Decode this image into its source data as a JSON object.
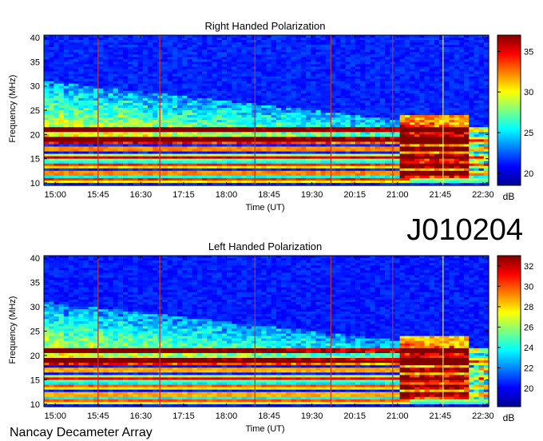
{
  "figure": {
    "station": "Nancay Decameter Array",
    "date_code": "J010204"
  },
  "chart_data": [
    {
      "type": "heatmap",
      "title": "Right Handed Polarization",
      "xlabel": "Time (UT)",
      "ylabel": "Frequency (MHz)",
      "x_ticks": [
        "15:00",
        "15:45",
        "16:30",
        "17:15",
        "18:00",
        "18:45",
        "19:30",
        "20:15",
        "21:00",
        "21:45",
        "22:30"
      ],
      "x_range": [
        "14:48",
        "22:36"
      ],
      "y_ticks": [
        10,
        15,
        20,
        25,
        30,
        35,
        40
      ],
      "ylim": [
        9.5,
        40.5
      ],
      "colorbar": {
        "label": "dB",
        "ticks": [
          20,
          25,
          30,
          35
        ],
        "range": [
          18.5,
          37
        ]
      },
      "colormap": "jet",
      "vertical_markers": [
        {
          "time": "15:45",
          "color": "#c03030"
        },
        {
          "time": "16:50",
          "color": "#c03030"
        },
        {
          "time": "18:30",
          "color": "#c03030"
        },
        {
          "time": "19:50",
          "color": "#c03030"
        },
        {
          "time": "20:55",
          "color": "#c03030"
        },
        {
          "time": "21:48",
          "color": "#e8e060"
        }
      ]
    },
    {
      "type": "heatmap",
      "title": "Left Handed Polarization",
      "xlabel": "Time (UT)",
      "ylabel": "Frequency (MHz)",
      "x_ticks": [
        "15:00",
        "15:45",
        "16:30",
        "17:15",
        "18:00",
        "18:45",
        "19:30",
        "20:15",
        "21:00",
        "21:45",
        "22:30"
      ],
      "x_range": [
        "14:48",
        "22:36"
      ],
      "y_ticks": [
        10,
        15,
        20,
        25,
        30,
        35,
        40
      ],
      "ylim": [
        9.5,
        40.5
      ],
      "colorbar": {
        "label": "dB",
        "ticks": [
          20,
          22,
          24,
          26,
          28,
          30,
          32
        ],
        "range": [
          18.2,
          33
        ]
      },
      "colormap": "jet",
      "vertical_markers": [
        {
          "time": "15:45",
          "color": "#c03030"
        },
        {
          "time": "16:50",
          "color": "#c03030"
        },
        {
          "time": "18:30",
          "color": "#c03030"
        },
        {
          "time": "19:50",
          "color": "#c03030"
        },
        {
          "time": "20:55",
          "color": "#c03030"
        },
        {
          "time": "21:48",
          "color": "#e8e060"
        }
      ]
    }
  ]
}
